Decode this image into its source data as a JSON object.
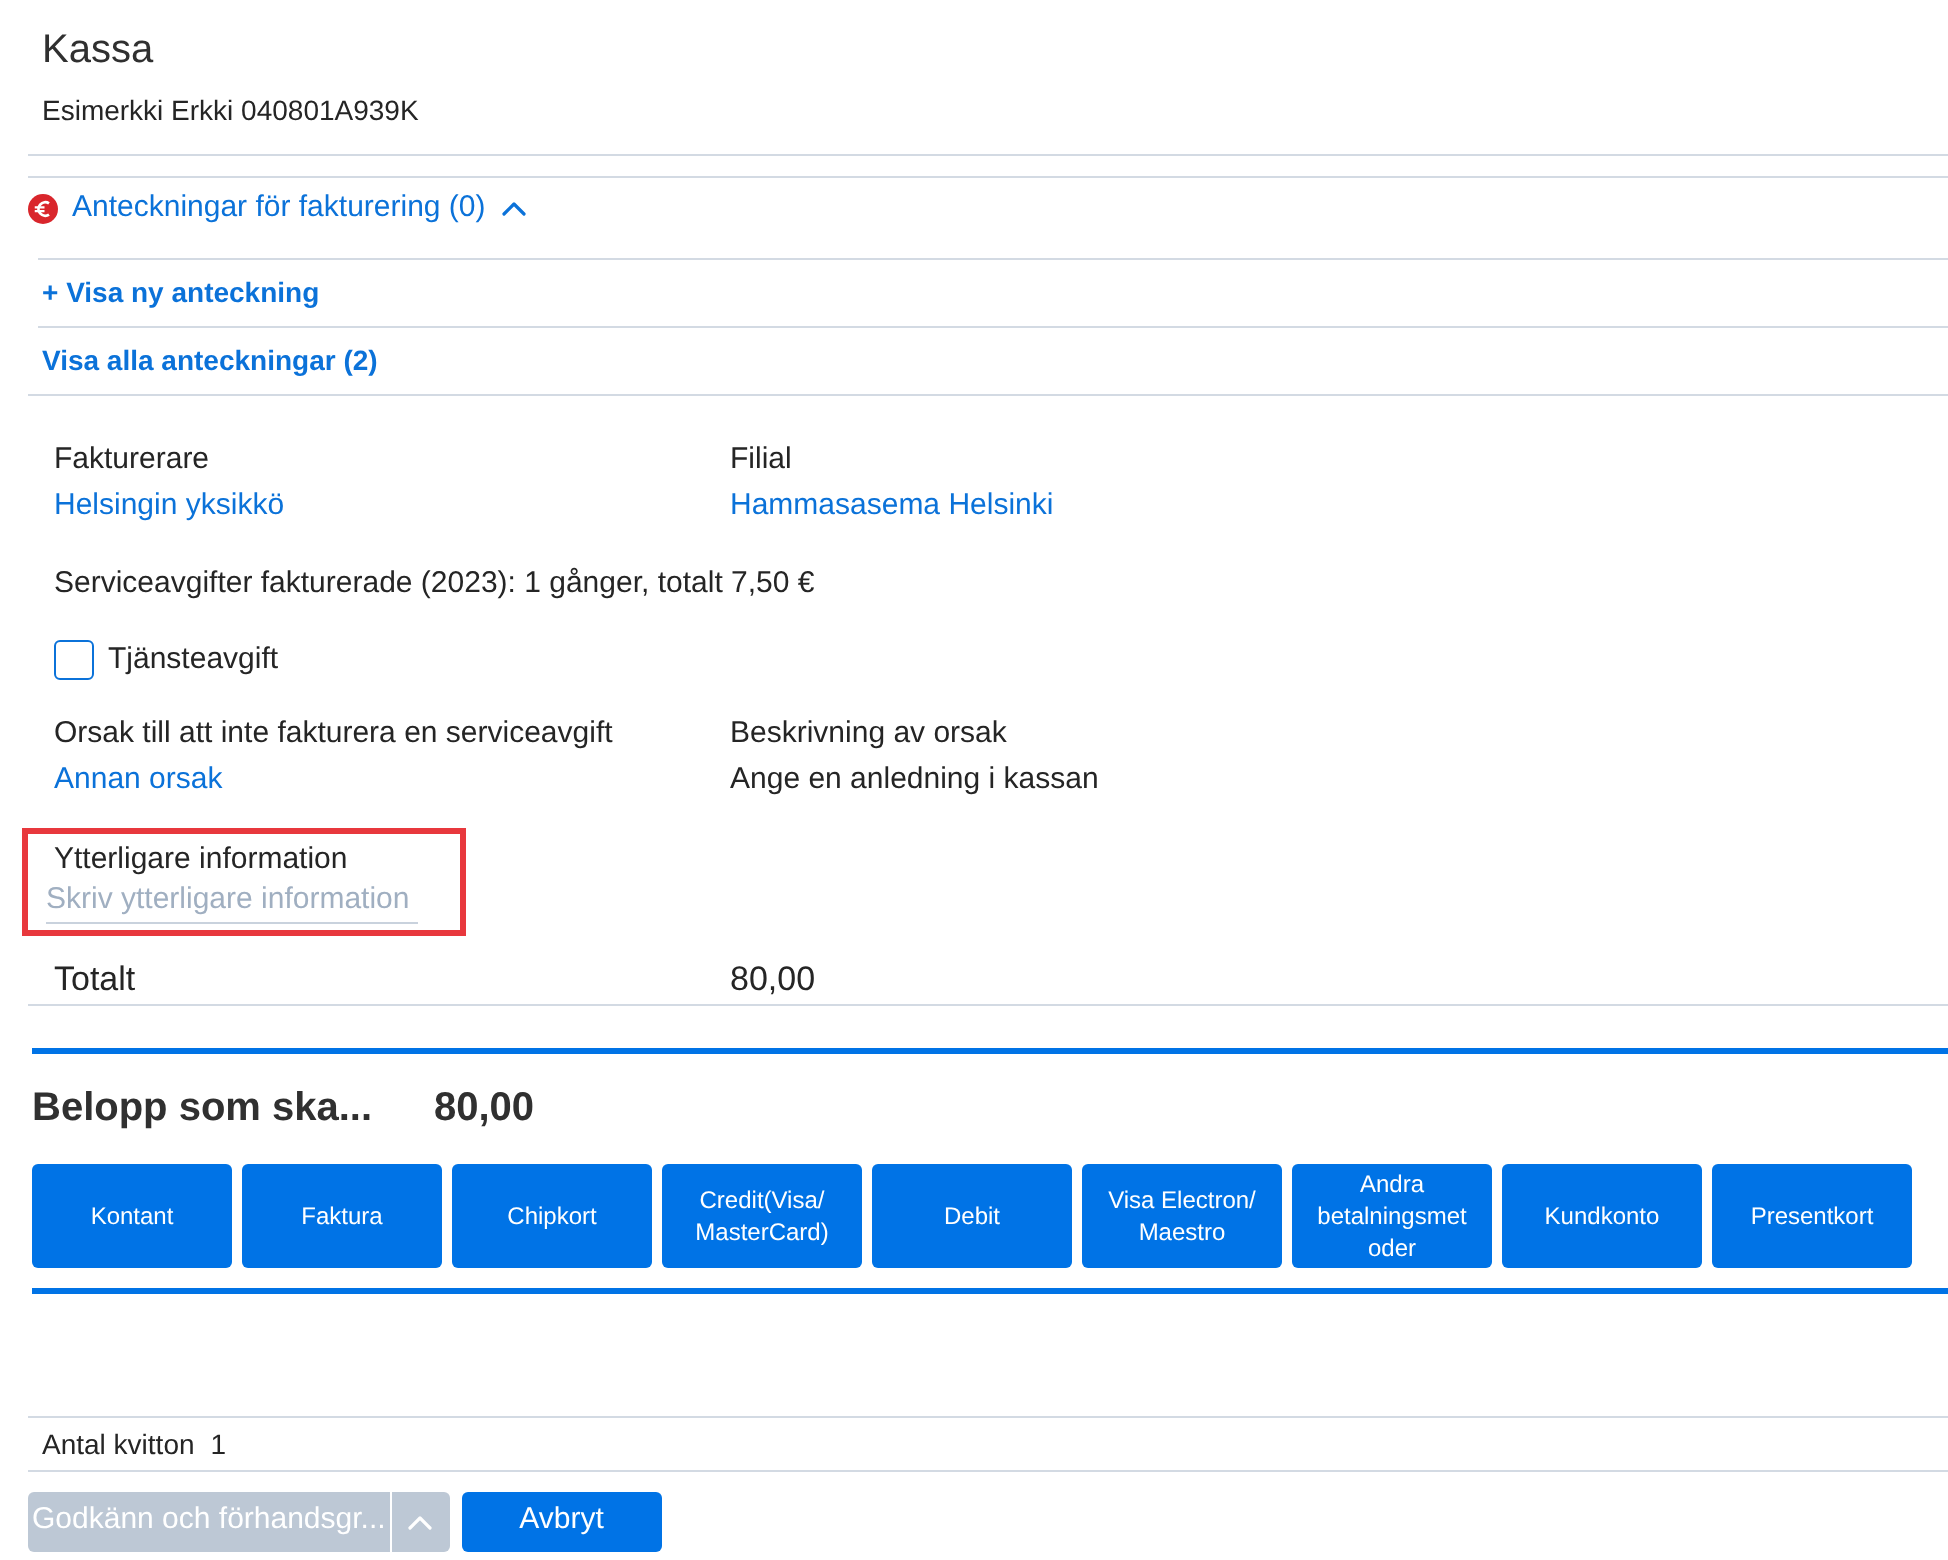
{
  "header": {
    "title": "Kassa",
    "subtitle": "Esimerkki Erkki 040801A939K"
  },
  "notes": {
    "title": "Anteckningar för fakturering (0)",
    "expanded": true,
    "links": [
      "+ Visa ny anteckning",
      "Visa alla anteckningar (2)"
    ]
  },
  "fields": [
    {
      "label": "Fakturerare",
      "value": "Helsingin yksikkö",
      "kind": "link"
    },
    {
      "label": "Filial",
      "value": "Hammasasema Helsinki",
      "kind": "link"
    }
  ],
  "service_fee_summary": "Serviceavgifter fakturerade (2023): 1 gånger, totalt 7,50 €",
  "service_fee": {
    "label": "Tjänsteavgift",
    "checked": false
  },
  "reason_fields": [
    {
      "label": "Orsak till att inte fakturera en serviceavgift",
      "value": "Annan orsak",
      "kind": "link"
    },
    {
      "label": "Beskrivning av orsak",
      "value": "Ange en anledning i kassan",
      "kind": "text"
    }
  ],
  "additional_info": {
    "label": "Ytterligare information",
    "placeholder": "Skriv ytterligare information",
    "highlighted": true
  },
  "total": {
    "label": "Totalt",
    "value": "80,00"
  },
  "payment": {
    "label": "Belopp som ska...",
    "amount": "80,00",
    "methods": [
      "Kontant",
      "Faktura",
      "Chipkort",
      "Credit(Visa/MasterCard)",
      "Debit",
      "Visa Electron/Maestro",
      "Andra betalningsmetoder",
      "Kundkonto",
      "Presentkort"
    ]
  },
  "receipts": {
    "label": "Antal kvitton",
    "value": "1"
  },
  "actions": [
    {
      "label": "Godkänn och förhandsgr...",
      "kind": "split",
      "disabled": true
    },
    {
      "label": "Avbryt",
      "kind": "plain",
      "disabled": false
    }
  ]
}
